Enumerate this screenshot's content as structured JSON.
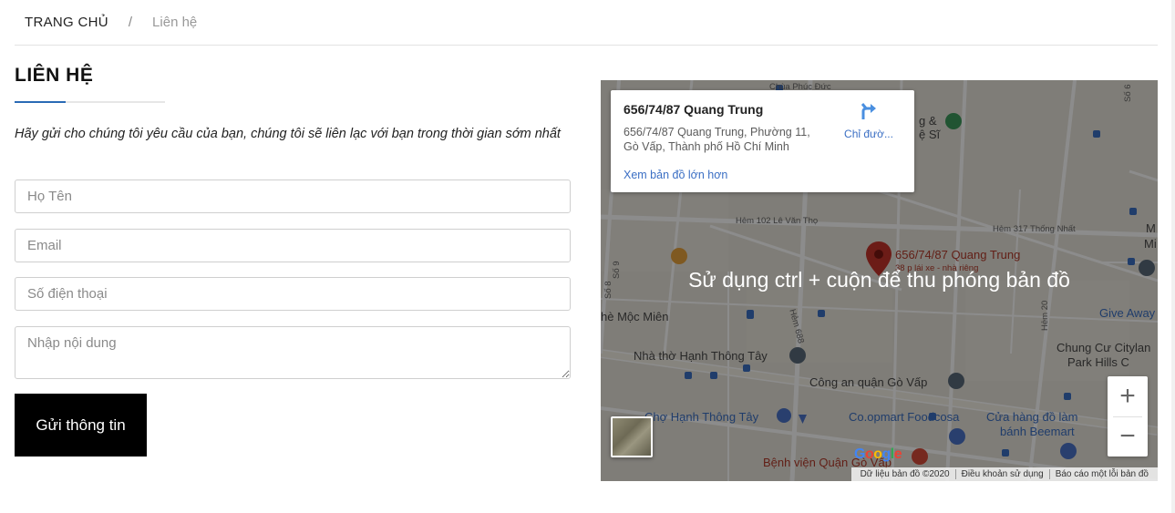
{
  "breadcrumb": {
    "home": "TRANG CHỦ",
    "separator": "/",
    "current": "Liên hệ"
  },
  "page": {
    "title": "LIÊN HỆ",
    "intro": "Hãy gửi cho chúng tôi yêu cầu của bạn, chúng tôi sẽ liên lạc với bạn trong thời gian sớm nhất"
  },
  "form": {
    "name_placeholder": "Họ Tên",
    "email_placeholder": "Email",
    "phone_placeholder": "Số điện thoại",
    "message_placeholder": "Nhập nội dung",
    "name_value": "",
    "email_value": "",
    "phone_value": "",
    "submit_label": "Gửi thông tin"
  },
  "map": {
    "info_card": {
      "name": "656/74/87 Quang Trung",
      "address": "656/74/87 Quang Trung, Phường 11, Gò Vấp, Thành phố Hồ Chí Minh",
      "directions_label": "Chỉ đườ...",
      "view_larger_label": "Xem bản đồ lớn hơn"
    },
    "overlay_message": "Sử dụng ctrl + cuộn để thu phóng bản đồ",
    "pin_label": "656/74/87 Quang Trung",
    "pin_sublabel": "38 p lái xe - nhà riêng",
    "places": {
      "top": "Chùa Phúc Đức",
      "church": "Nhà thờ Hạnh Thông Tây",
      "police": "Công an quận Gò Vấp",
      "market": "Chợ Hạnh Thông Tây",
      "coopmart": "Co.opmart Foodcosa",
      "store_line1": "Cửa hàng đồ làm",
      "store_line2": "bánh Beemart",
      "hospital": "Bệnh viện Quận Gò Vấp",
      "apartment_line1": "Chung Cư Citylan",
      "apartment_line2": "Park Hills C",
      "giveaway": "Give Away",
      "mocmien": "hè Mộc Miên",
      "right_top": "g & ",
      "right_top2": "ệ Sĩ",
      "right_mi": "Mi",
      "right_m": "M"
    },
    "streets": {
      "hem102": "Hẻm 102 Lê Văn Thọ",
      "hem317": "Hẻm 317 Thống Nhất",
      "hem688": "Hẻm 688",
      "hem20": "Hẻm 20",
      "so8": "Số 8",
      "so6": "Số 6",
      "so9": "Số 9"
    },
    "google_logo": "Google",
    "attribution": {
      "data": "Dữ liệu bản đồ ©2020",
      "terms": "Điều khoản sử dụng",
      "report": "Báo cáo một lỗi bản đồ"
    },
    "zoom_in": "+",
    "zoom_out": "−"
  }
}
